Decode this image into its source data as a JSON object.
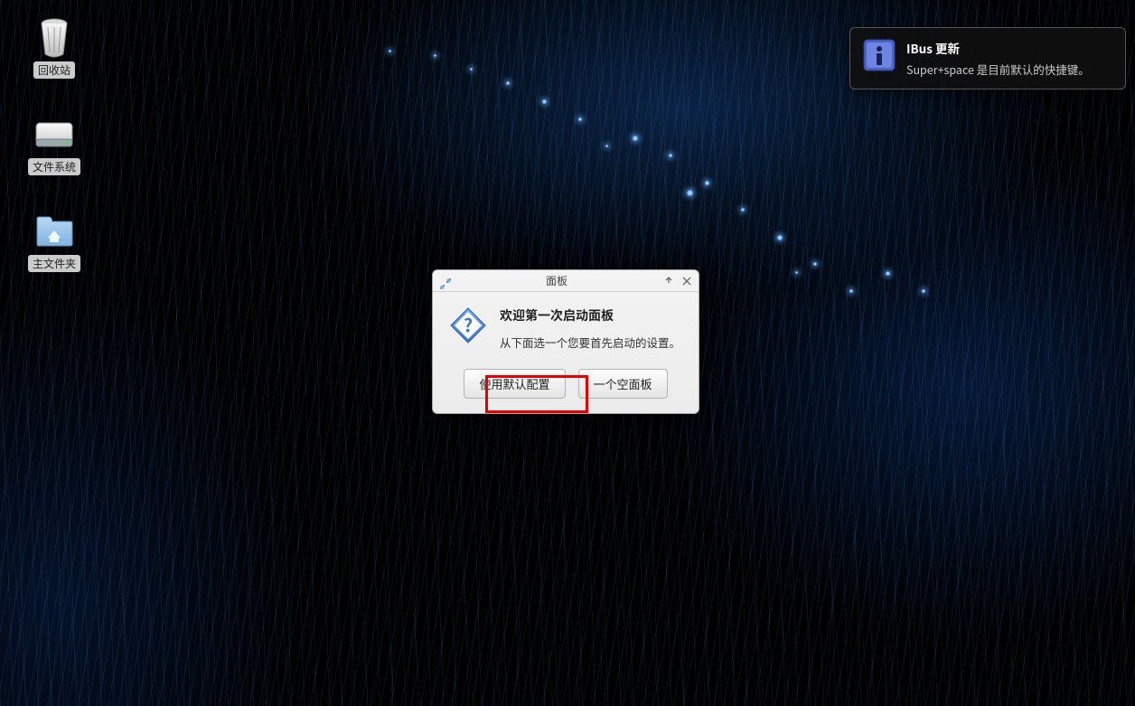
{
  "desktop": {
    "icons": [
      {
        "name": "trash",
        "label": "回收站"
      },
      {
        "name": "filesystem",
        "label": "文件系统"
      },
      {
        "name": "home",
        "label": "主文件夹"
      }
    ]
  },
  "dialog": {
    "title": "面板",
    "heading": "欢迎第一次启动面板",
    "message": "从下面选一个您要首先启动的设置。",
    "buttons": {
      "default_config": "使用默认配置",
      "empty_panel": "一个空面板"
    }
  },
  "notification": {
    "title": "IBus 更新",
    "body": "Super+space 是目前默认的快捷键。"
  }
}
